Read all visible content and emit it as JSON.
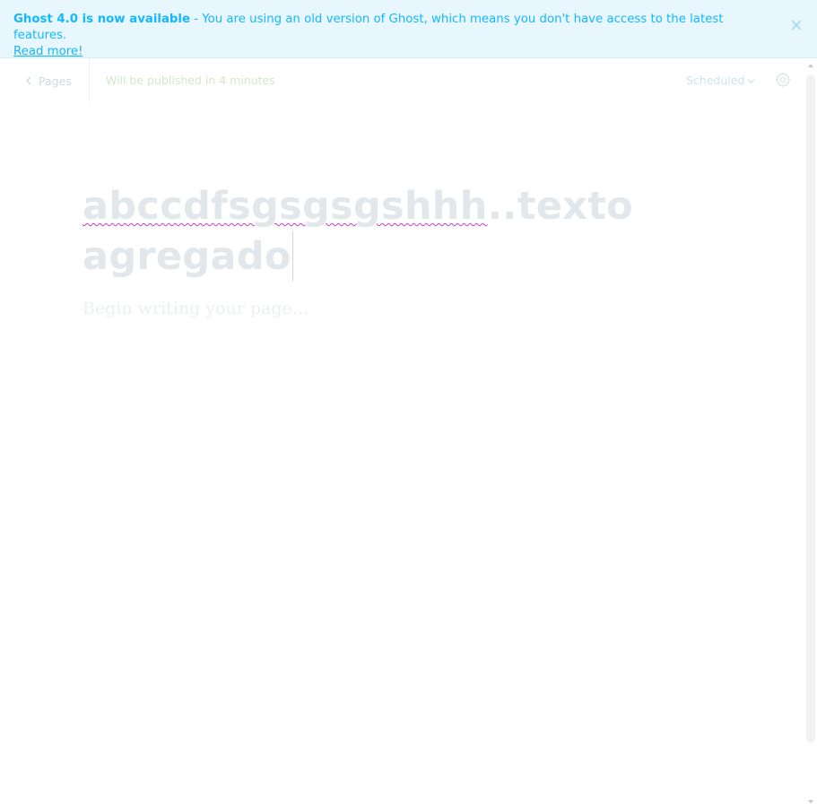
{
  "banner": {
    "title": "Ghost 4.0 is now available",
    "message": " - You are using an old version of Ghost, which means you don't have access to the latest features.",
    "link": "Read more!",
    "close_icon": "close-icon"
  },
  "topbar": {
    "back_label": "Pages",
    "back_icon": "chevron-left-icon",
    "status_text": "Will be published in 4 minutes",
    "publish_label": "Scheduled",
    "publish_icon": "chevron-down-icon",
    "settings_icon": "gear-icon"
  },
  "editor": {
    "title_misspelled": "abccdfsgsgsgshhh",
    "title_rest_line1": "..texto",
    "title_line2": "agregado",
    "body_placeholder": "Begin writing your page..."
  },
  "colors": {
    "banner_bg": "#e8f6fd",
    "banner_text": "#14b8ff",
    "spellcheck": "#c43dc6"
  }
}
